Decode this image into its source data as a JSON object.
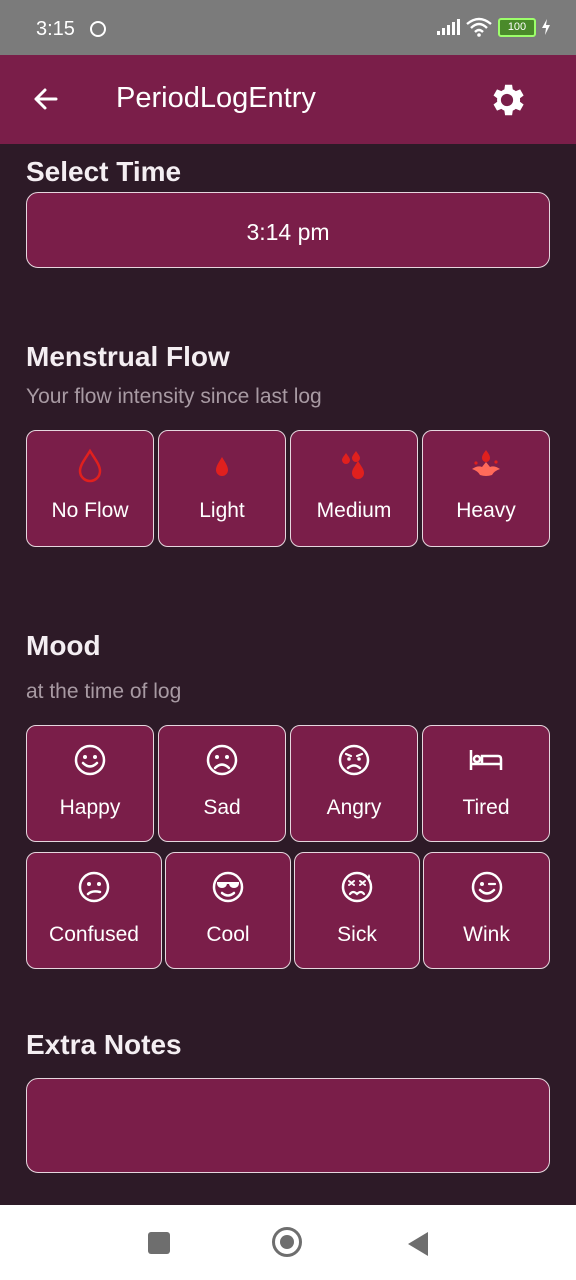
{
  "status_bar": {
    "time": "3:15",
    "battery": "100"
  },
  "app_bar": {
    "title": "PeriodLogEntry"
  },
  "select_time": {
    "title": "Select Time",
    "value": "3:14 pm"
  },
  "menstrual_flow": {
    "title": "Menstrual Flow",
    "subtitle": "Your flow intensity since last log",
    "options": [
      {
        "label": "No Flow",
        "icon": "drop-outline-icon"
      },
      {
        "label": "Light",
        "icon": "drop-icon"
      },
      {
        "label": "Medium",
        "icon": "drops-icon"
      },
      {
        "label": "Heavy",
        "icon": "splash-icon"
      }
    ]
  },
  "mood": {
    "title": "Mood",
    "subtitle": "at the time of log",
    "options": [
      {
        "label": "Happy",
        "icon": "smile-icon"
      },
      {
        "label": "Sad",
        "icon": "sad-icon"
      },
      {
        "label": "Angry",
        "icon": "angry-icon"
      },
      {
        "label": "Tired",
        "icon": "bed-icon"
      },
      {
        "label": "Confused",
        "icon": "confused-icon"
      },
      {
        "label": "Cool",
        "icon": "sunglasses-icon"
      },
      {
        "label": "Sick",
        "icon": "sick-icon"
      },
      {
        "label": "Wink",
        "icon": "wink-icon"
      }
    ]
  },
  "extra_notes": {
    "title": "Extra Notes",
    "value": ""
  },
  "colors": {
    "accent": "#7a1e49",
    "background": "#2d1a27",
    "flow_icon": "#e0201e"
  }
}
